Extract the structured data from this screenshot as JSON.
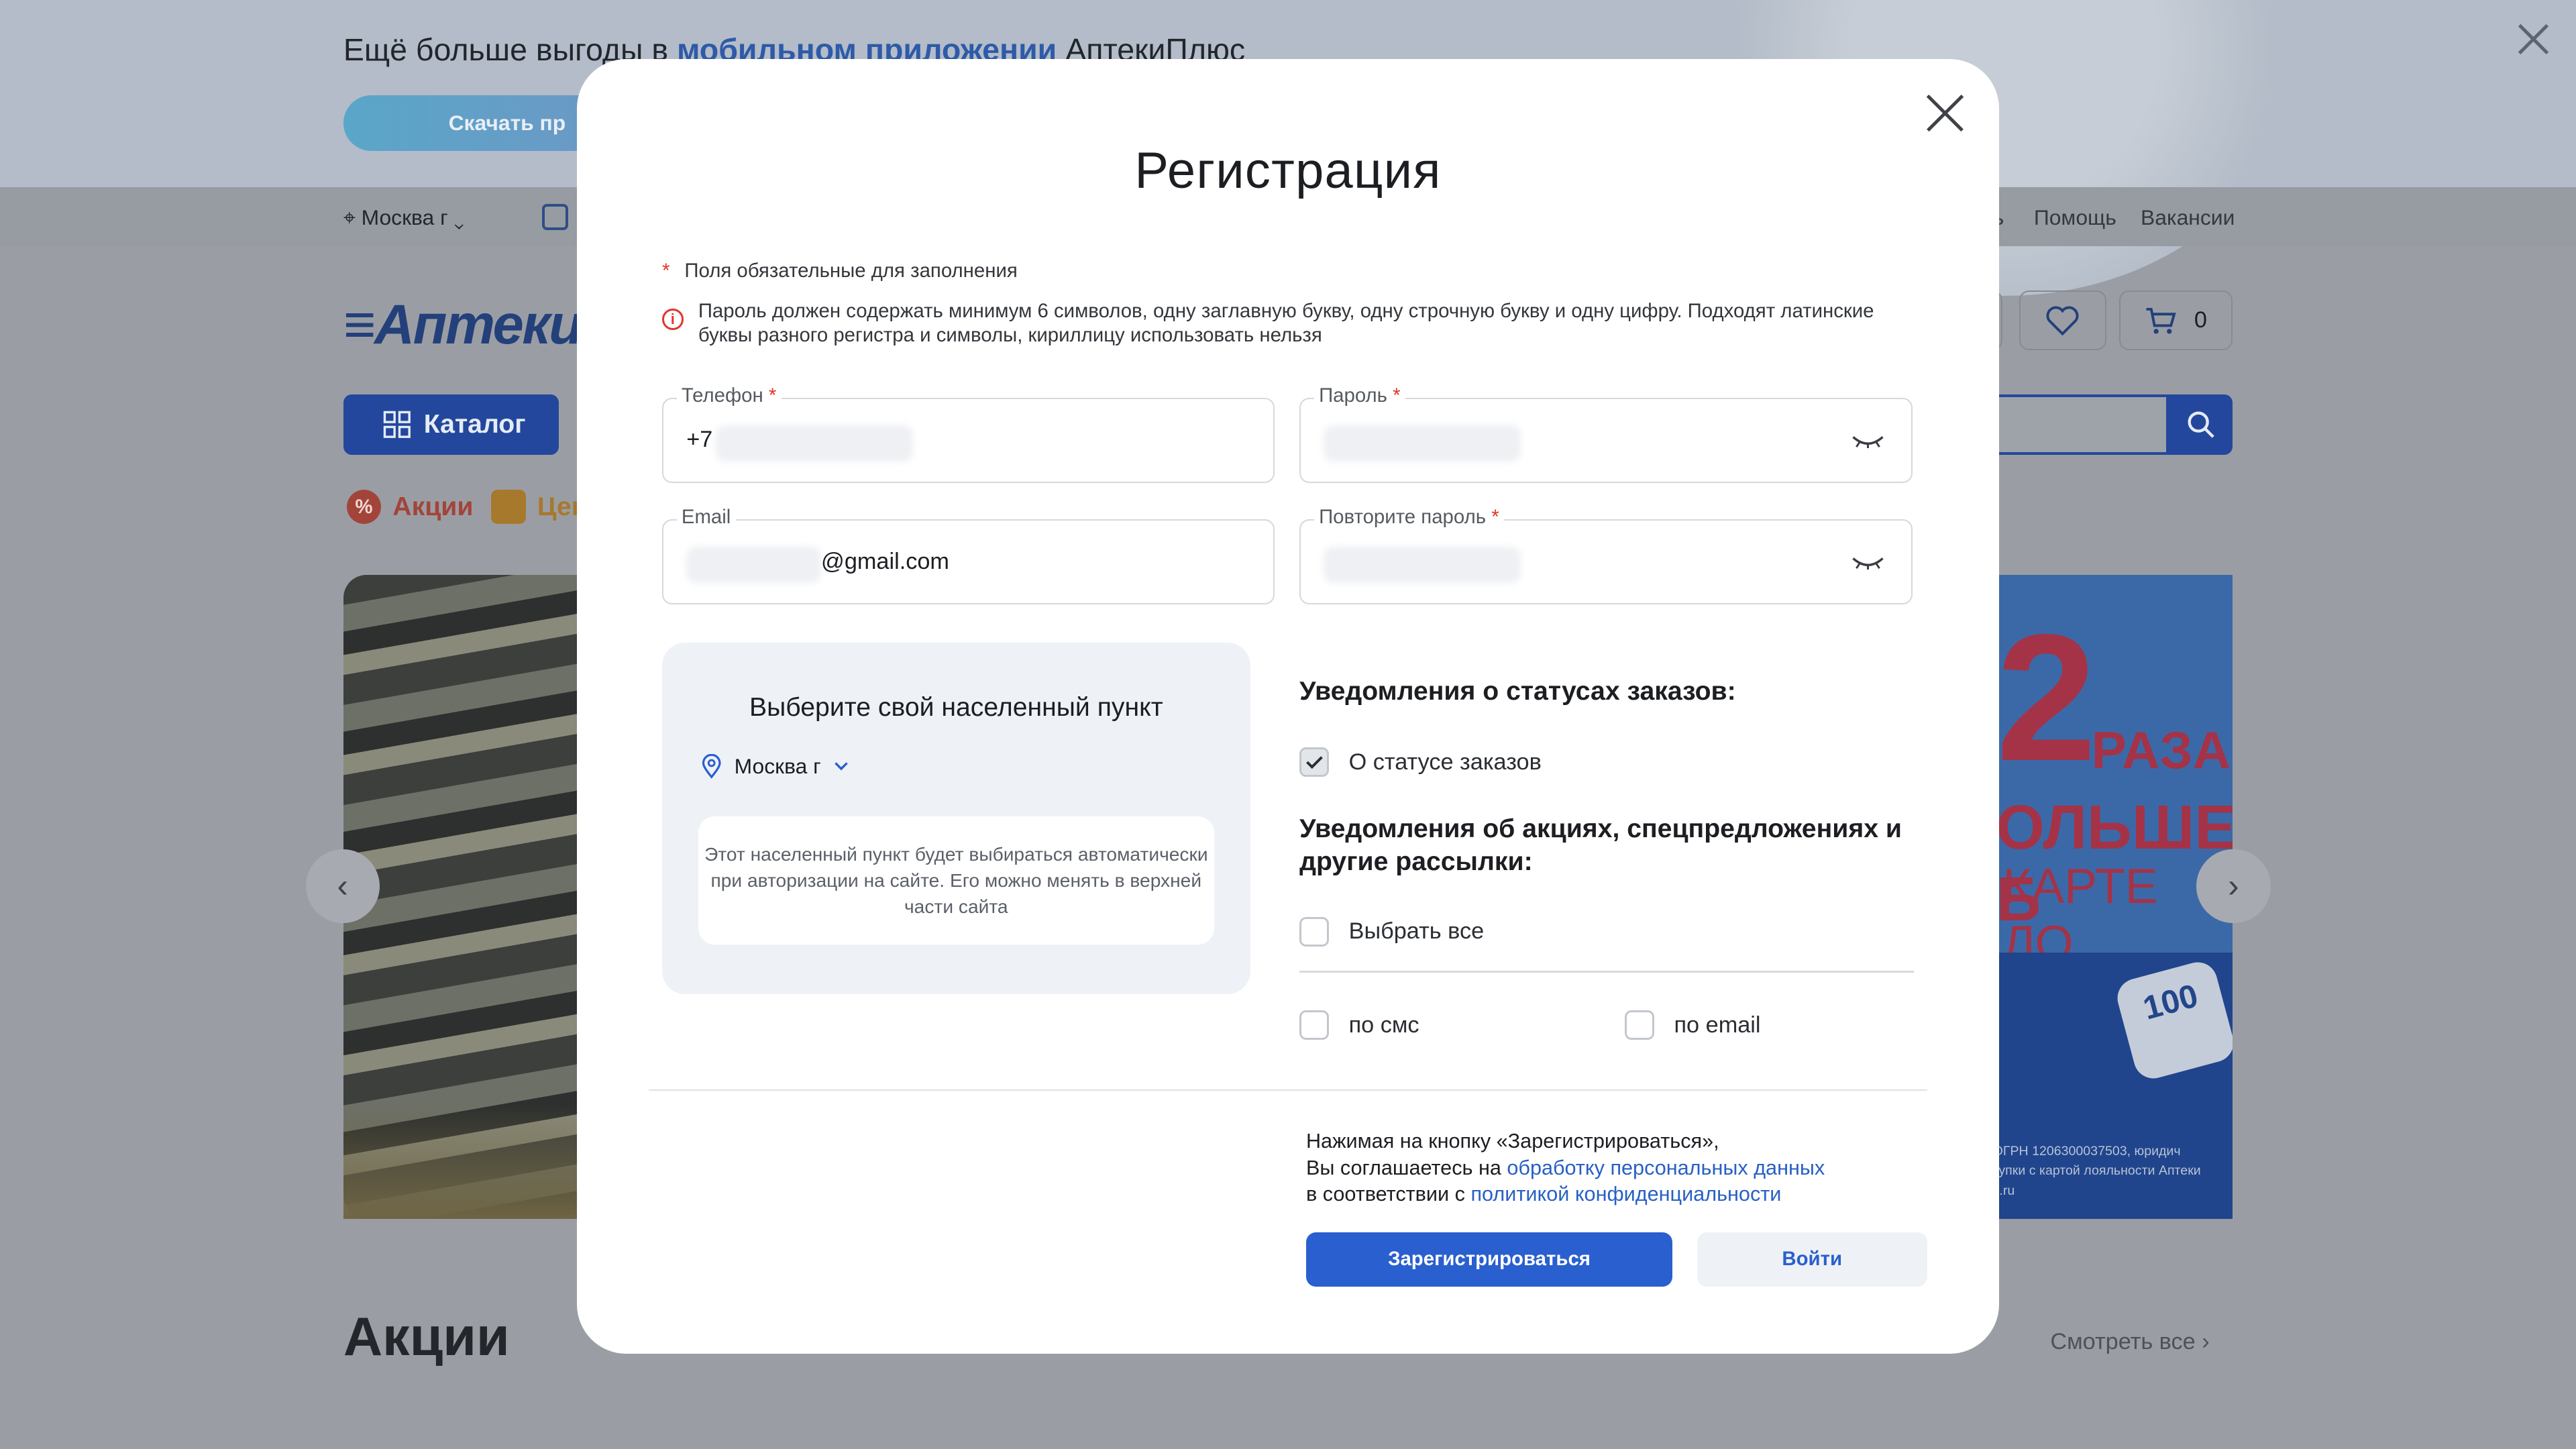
{
  "promo": {
    "text_before": "Ещё больше выгоды в",
    "text_link": "мобильном приложении",
    "text_after": "АптекиПлюс",
    "button": "Скачать пр"
  },
  "topbar": {
    "city": "Москва г",
    "cut_label": "ь",
    "help": "Помощь",
    "vacancies": "Вакансии"
  },
  "header": {
    "logo": "Аптеки",
    "cart_count": "0",
    "catalog": "Каталог",
    "chip_sales": "Акции",
    "chip_prices": "Цен"
  },
  "banner": {
    "big_number": "2",
    "raza": "РАЗА",
    "line2": "ОЛЬШЕ Б",
    "line3": "КАРТЕ ЛО",
    "bonus": "100",
    "tiny": "ОГРН 1206300037503, юридич\nкупки с картой лояльности Аптеки\ns.ru"
  },
  "page": {
    "section_title": "Акции",
    "see_all": "Смотреть все"
  },
  "modal": {
    "title": "Регистрация",
    "required_note": "Поля обязательные для заполнения",
    "password_note": "Пароль должен содержать минимум 6 символов, одну заглавную букву, одну строчную букву и одну цифру. Подходят латинские буквы разного регистра и символы, кириллицу использовать нельзя",
    "phone": {
      "label": "Телефон",
      "value": "+7"
    },
    "email": {
      "label": "Email",
      "value": "@gmail.com"
    },
    "password": {
      "label": "Пароль"
    },
    "password_repeat": {
      "label": "Повторите пароль"
    },
    "city_panel": {
      "title": "Выберите свой населенный пункт",
      "city": "Москва г",
      "info": "Этот населенный пункт будет выбираться автоматически при авторизации на сайте. Его можно менять в верхней части сайта"
    },
    "order_notifications": {
      "title": "Уведомления о статусах заказов:",
      "status_label": "О статусе заказов",
      "status_checked": true
    },
    "promo_notifications": {
      "title": "Уведомления об акциях, спецпредложениях и другие рассылки:",
      "select_all": "Выбрать все",
      "sms": "по смс",
      "email": "по email"
    },
    "consent": {
      "line1": "Нажимая на кнопку «Зарегистрироваться»,",
      "line2_prefix": "Вы соглашаетесь на",
      "line2_link": "обработку персональных данных",
      "line3_prefix": "в соответствии с",
      "line3_link": "политикой конфиденциальности"
    },
    "register_button": "Зарегистрироваться",
    "login_button": "Войти"
  }
}
